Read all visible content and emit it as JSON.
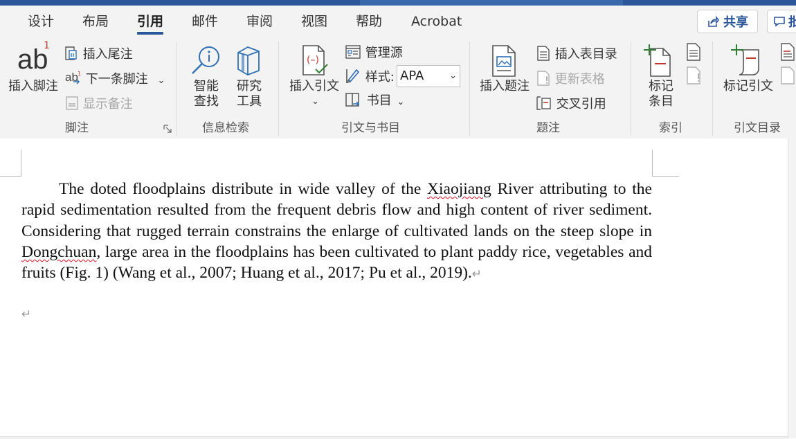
{
  "tabs": [
    {
      "label": "设计"
    },
    {
      "label": "布局"
    },
    {
      "label": "引用",
      "active": true
    },
    {
      "label": "邮件"
    },
    {
      "label": "审阅"
    },
    {
      "label": "视图"
    },
    {
      "label": "帮助"
    },
    {
      "label": "Acrobat"
    }
  ],
  "header": {
    "share_label": "共享",
    "comment_label": "批"
  },
  "ribbon": {
    "footnotes": {
      "ab_glyph": "ab",
      "superscript": "1",
      "insert_footnote": "插入脚注",
      "insert_endnote": "插入尾注",
      "next_footnote": "下一条脚注",
      "show_notes": "显示备注",
      "group_label": "脚注"
    },
    "research": {
      "smart_lookup_1": "智能",
      "smart_lookup_2": "查找",
      "researcher_1": "研究",
      "researcher_2": "工具",
      "group_label": "信息检索"
    },
    "citations": {
      "insert_citation": "插入引文",
      "manage_sources": "管理源",
      "style_label": "样式:",
      "style_value": "APA",
      "bibliography": "书目",
      "group_label": "引文与书目"
    },
    "captions": {
      "insert_caption": "插入题注",
      "insert_table_of_figures": "插入表目录",
      "update_table": "更新表格",
      "cross_reference": "交叉引用",
      "group_label": "题注"
    },
    "index": {
      "mark_entry_1": "标记",
      "mark_entry_2": "条目",
      "group_label": "索引"
    },
    "toa": {
      "mark_citation": "标记引文",
      "group_label": "引文目录"
    }
  },
  "document": {
    "p1": "The doted floodplains distribute in wide valley of the ",
    "w1": "Xiaojiang",
    "p2": " River attributing to the rapid sedimentation resulted from the frequent debris flow and high content of river sediment. Considering that rugged terrain constrains the enlarge of cultivated lands on the steep slope in ",
    "w2": "Dongchuan",
    "p3": ", large area in the floodplains has been cultivated to plant paddy rice, vegetables and fruits (Fig. 1) (Wang et al., 2007; Huang et al., 2017; Pu et al., 2019).",
    "paragraph_mark": "↵"
  },
  "colors": {
    "accent": "#2b579a",
    "icon_blue": "#2e6fb5",
    "icon_red": "#c0392b",
    "icon_green": "#2e7d32",
    "ribbon_bg": "#f3f3f3"
  }
}
